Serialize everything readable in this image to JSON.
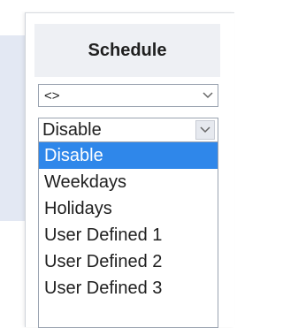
{
  "header": {
    "title": "Schedule"
  },
  "filter_select": {
    "value": "<>",
    "icon": "chevron-down-icon"
  },
  "schedule_select": {
    "value": "Disable",
    "icon": "chevron-down-icon",
    "options": [
      {
        "label": "Disable",
        "selected": true
      },
      {
        "label": "Weekdays",
        "selected": false
      },
      {
        "label": "Holidays",
        "selected": false
      },
      {
        "label": "User Defined 1",
        "selected": false
      },
      {
        "label": "User Defined 2",
        "selected": false
      },
      {
        "label": "User Defined 3",
        "selected": false
      }
    ]
  },
  "colors": {
    "highlight": "#2f87ea",
    "header_bg": "#eef0f4"
  }
}
